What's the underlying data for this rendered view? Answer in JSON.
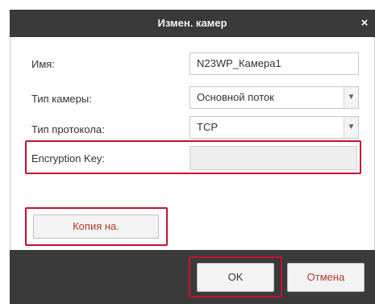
{
  "dialog": {
    "title": "Измен. камер",
    "close_symbol": "×"
  },
  "form": {
    "name_label": "Имя:",
    "name_value": "N23WP_Камера1",
    "camera_type_label": "Тип камеры:",
    "camera_type_value": "Основной поток",
    "protocol_label": "Тип протокола:",
    "protocol_value": "TCP",
    "encryption_label": "Encryption Key:",
    "encryption_value": ""
  },
  "buttons": {
    "copy_to": "Копия на.",
    "ok": "OK",
    "cancel": "Отмена"
  },
  "icons": {
    "dropdown": "chevron-down-icon",
    "close": "close-icon"
  },
  "colors": {
    "titlebar": "#3a3a3a",
    "highlight": "#c8102e"
  }
}
